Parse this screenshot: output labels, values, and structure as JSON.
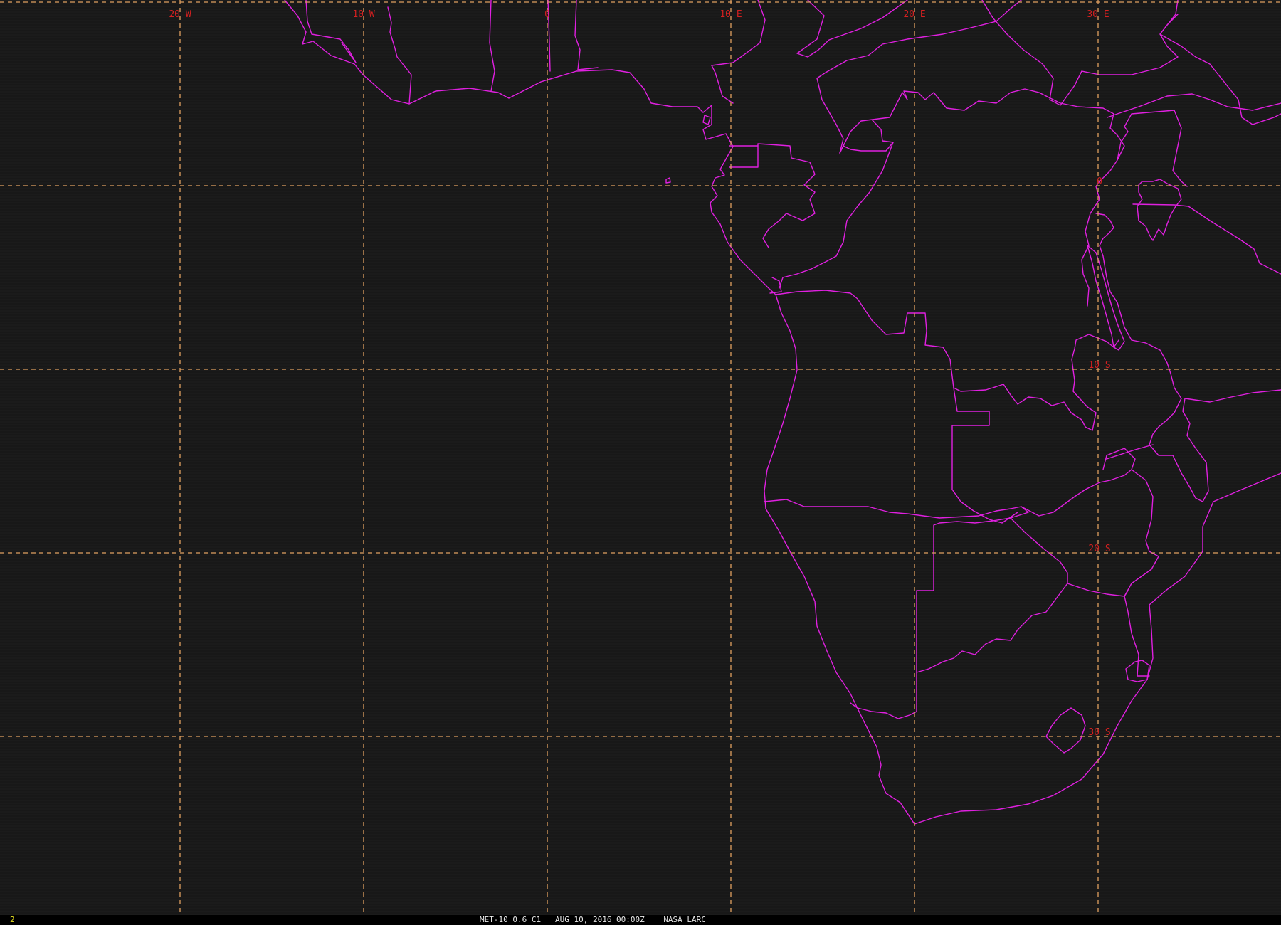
{
  "map": {
    "projection": "geostationary",
    "colors": {
      "background": "#1a1a1a",
      "grid": "#e0a060",
      "grid_labels": "#d42020",
      "borders": "#e020e0"
    },
    "longitudes": [
      {
        "label": "20 W",
        "value": -20
      },
      {
        "label": "10 W",
        "value": -10
      },
      {
        "label": "0",
        "value": 0
      },
      {
        "label": "10 E",
        "value": 10
      },
      {
        "label": "20 E",
        "value": 20
      },
      {
        "label": "30 E",
        "value": 30
      }
    ],
    "latitudes": [
      {
        "label": "0",
        "value": 0
      },
      {
        "label": "10 S",
        "value": -10
      },
      {
        "label": "20 S",
        "value": -20
      },
      {
        "label": "30 S",
        "value": -30
      }
    ]
  },
  "status_bar": {
    "frame_number": "2",
    "satellite_band": "MET-10 0.6 C1",
    "datetime": "AUG 10, 2016 00:00Z",
    "source": "NASA LARC"
  }
}
